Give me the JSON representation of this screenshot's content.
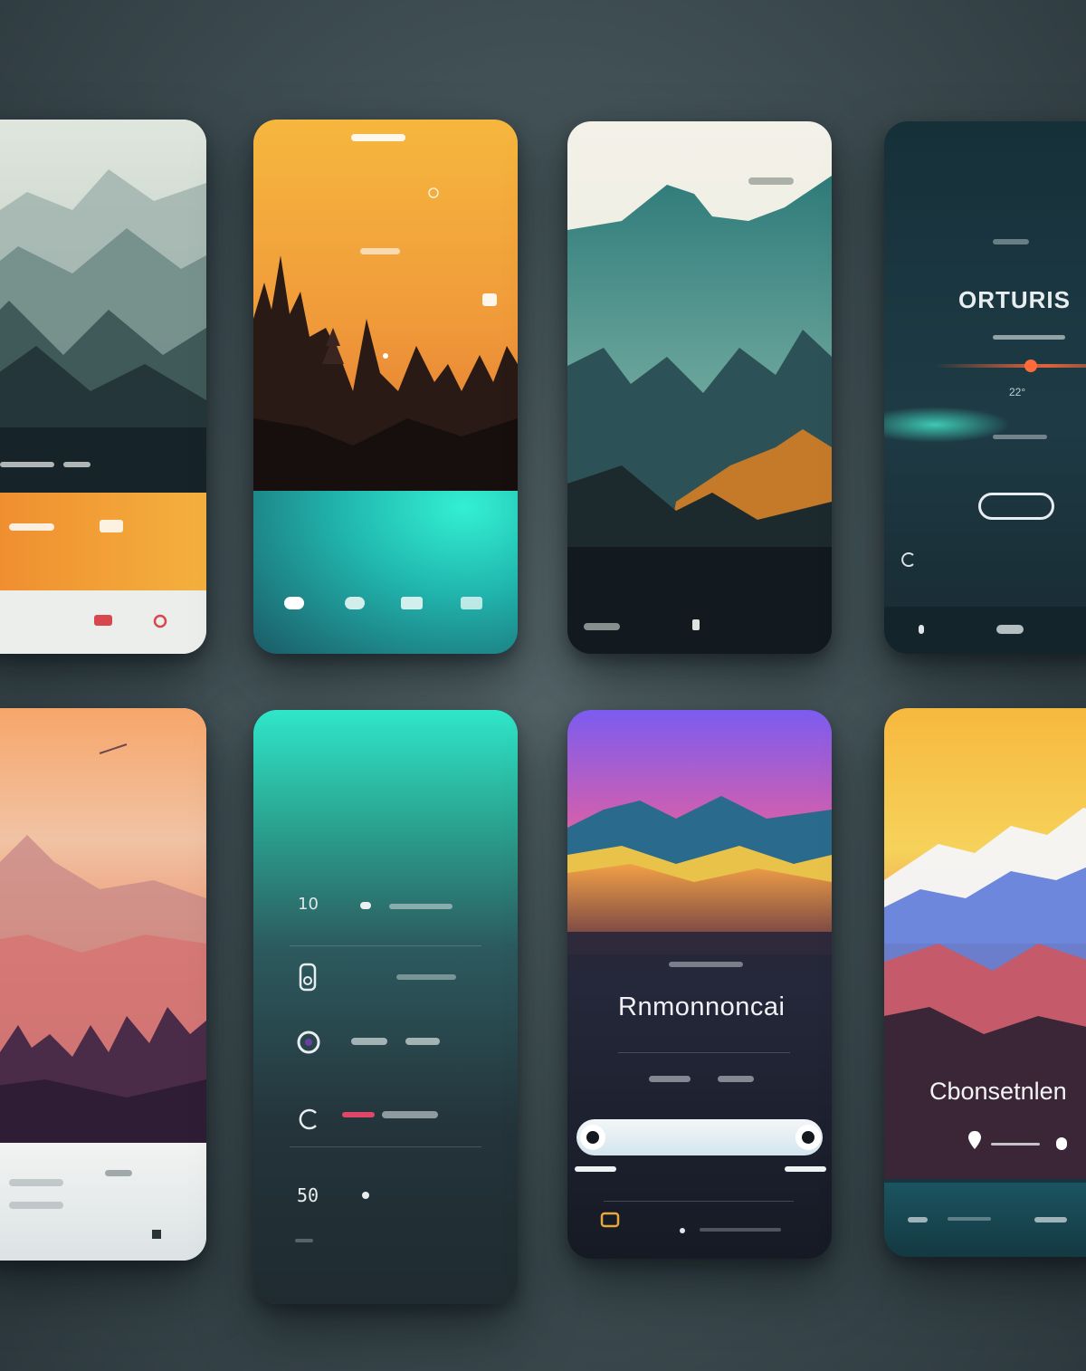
{
  "cards": {
    "c3": {
      "label": "Rnmonnoncai"
    },
    "c4": {
      "title": "ORTURIS",
      "value": "22°"
    },
    "c6": {
      "value": "50"
    },
    "c8": {
      "label": "Cbonsetnlen"
    }
  },
  "icons": [
    "gear-icon",
    "play-icon",
    "chat-icon",
    "heart-icon",
    "circle-icon",
    "list-icon",
    "bell-icon",
    "nav-icon",
    "shield-icon",
    "clock-icon"
  ],
  "colors": {
    "accent_orange": "#f0a43a",
    "accent_teal": "#2fe6c9",
    "dark_panel": "#1c2f38",
    "sunset_purple": "#7b5cf0"
  }
}
